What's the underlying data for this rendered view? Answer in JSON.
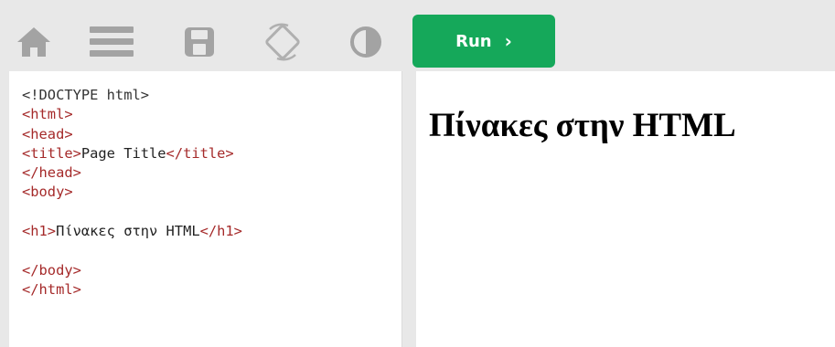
{
  "toolbar": {
    "icons": [
      "home-icon",
      "menu-icon",
      "save-icon",
      "rotate-icon",
      "contrast-icon"
    ],
    "run_label": "Run"
  },
  "code": {
    "lines": [
      {
        "parts": [
          [
            "doctype",
            "<!DOCTYPE html>"
          ]
        ]
      },
      {
        "parts": [
          [
            "tag",
            "<html>"
          ]
        ]
      },
      {
        "parts": [
          [
            "tag",
            "<head>"
          ]
        ]
      },
      {
        "parts": [
          [
            "tag",
            "<title>"
          ],
          [
            "txt",
            "Page Title"
          ],
          [
            "tag",
            "</title>"
          ]
        ]
      },
      {
        "parts": [
          [
            "tag",
            "</head>"
          ]
        ]
      },
      {
        "parts": [
          [
            "tag",
            "<body>"
          ]
        ]
      },
      {
        "parts": []
      },
      {
        "parts": [
          [
            "tag",
            "<h1>"
          ],
          [
            "txt",
            "Πίνακες στην HTML"
          ],
          [
            "tag",
            "</h1>"
          ]
        ]
      },
      {
        "parts": []
      },
      {
        "parts": [
          [
            "tag",
            "</body>"
          ]
        ]
      },
      {
        "parts": [
          [
            "tag",
            "</html>"
          ]
        ]
      }
    ]
  },
  "result": {
    "h1": "Πίνακες στην HTML"
  },
  "colors": {
    "run_button": "#15a85a",
    "toolbar_bg": "#e8e8e8",
    "tag": "#a52a2a",
    "icon": "#999999"
  }
}
